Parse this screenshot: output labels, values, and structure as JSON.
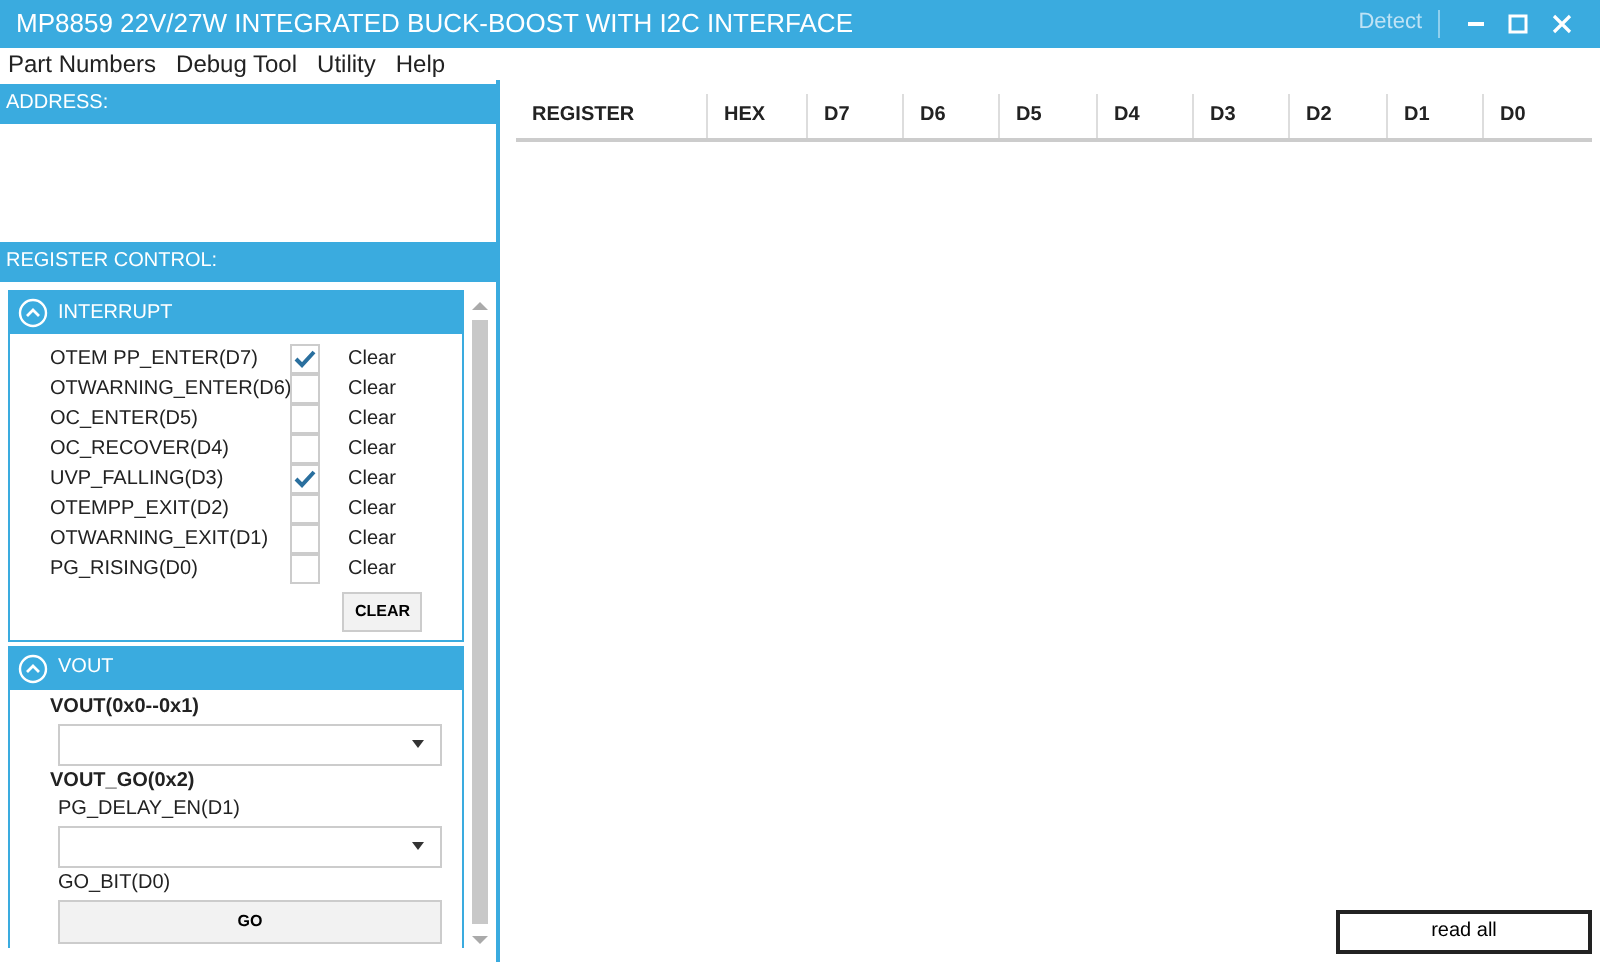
{
  "window": {
    "title": "MP8859 22V/27W INTEGRATED BUCK-BOOST WITH I2C INTERFACE",
    "detect": "Detect"
  },
  "menu": [
    "Part Numbers",
    "Debug Tool",
    "Utility",
    "Help"
  ],
  "address": {
    "header": "ADDRESS:"
  },
  "register_control": {
    "header": "REGISTER CONTROL:"
  },
  "interrupt": {
    "title": "INTERRUPT",
    "expanded": true,
    "clear_button": "CLEAR",
    "rows": [
      {
        "label": "OTEM PP_ENTER(D7)",
        "checked": true,
        "action": "Clear"
      },
      {
        "label": "OTWARNING_ENTER(D6)",
        "checked": false,
        "action": "Clear"
      },
      {
        "label": "OC_ENTER(D5)",
        "checked": false,
        "action": "Clear"
      },
      {
        "label": "OC_RECOVER(D4)",
        "checked": false,
        "action": "Clear"
      },
      {
        "label": "UVP_FALLING(D3)",
        "checked": true,
        "action": "Clear"
      },
      {
        "label": "OTEMPP_EXIT(D2)",
        "checked": false,
        "action": "Clear"
      },
      {
        "label": "OTWARNING_EXIT(D1)",
        "checked": false,
        "action": "Clear"
      },
      {
        "label": "PG_RISING(D0)",
        "checked": false,
        "action": "Clear"
      }
    ]
  },
  "vout": {
    "title": "VOUT",
    "expanded": true,
    "items": [
      {
        "kind": "heading",
        "label": "VOUT(0x0--0x1)"
      },
      {
        "kind": "select"
      },
      {
        "kind": "heading",
        "label": "VOUT_GO(0x2)"
      },
      {
        "kind": "sublabel",
        "label": "PG_DELAY_EN(D1)"
      },
      {
        "kind": "select"
      },
      {
        "kind": "sublabel",
        "label": "GO_BIT(D0)"
      },
      {
        "kind": "button",
        "label": "GO"
      }
    ]
  },
  "table": {
    "columns": [
      "REGISTER",
      "HEX",
      "D7",
      "D6",
      "D5",
      "D4",
      "D3",
      "D2",
      "D1",
      "D0"
    ]
  },
  "read_all_button": "read all"
}
